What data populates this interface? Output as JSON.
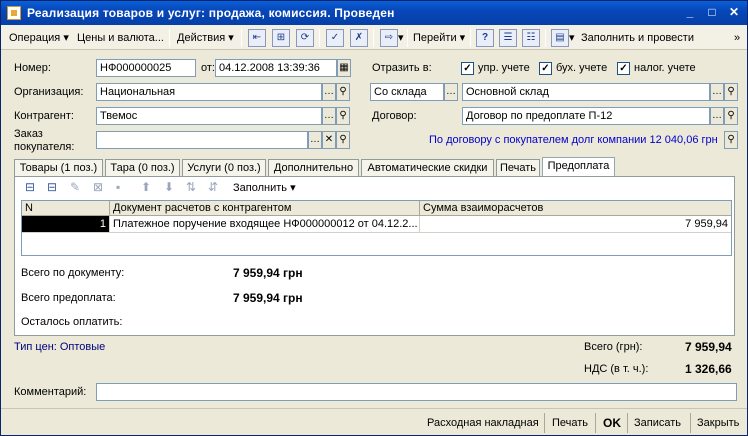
{
  "window": {
    "title": "Реализация товаров и услуг: продажа, комиссия. Проведен",
    "controls": [
      "_",
      "□",
      "✕"
    ]
  },
  "toolbar": {
    "operation": "Операция",
    "prices": "Цены и валюта...",
    "actions": "Действия",
    "goto": "Перейти",
    "help": "?",
    "fill_and_post": "Заполнить и провести"
  },
  "header": {
    "number_label": "Номер:",
    "number_value": "НФ000000025",
    "from_label": "от:",
    "date_value": "04.12.2008 13:39:36",
    "reflect_label": "Отразить в:",
    "reflect_checks": [
      {
        "label": "упр. учете",
        "checked": true
      },
      {
        "label": "бух. учете",
        "checked": true
      },
      {
        "label": "налог. учете",
        "checked": true
      }
    ],
    "org_label": "Организация:",
    "org_value": "Национальная",
    "warehouse_type_value": "Со склада",
    "warehouse_value": "Основной склад",
    "contractor_label": "Контрагент:",
    "contractor_value": "Твемос",
    "contract_label": "Договор:",
    "contract_value": "Договор по предоплате П-12",
    "order_label_1": "Заказ",
    "order_label_2": "покупателя:",
    "order_value": "",
    "debt_link": "По договору с покупателем долг компании 12 040,06 грн"
  },
  "tabs": [
    {
      "label": "Товары (1 поз.)",
      "active": false
    },
    {
      "label": "Тара (0 поз.)",
      "active": false
    },
    {
      "label": "Услуги (0 поз.)",
      "active": false
    },
    {
      "label": "Дополнительно",
      "active": false
    },
    {
      "label": "Автоматические скидки",
      "active": false
    },
    {
      "label": "Печать",
      "active": false
    },
    {
      "label": "Предоплата",
      "active": true
    }
  ],
  "prepayment": {
    "fill_label": "Заполнить",
    "columns": [
      "N",
      "Документ расчетов с контрагентом",
      "Сумма взаиморасчетов"
    ],
    "rows": [
      {
        "n": "1",
        "document": "Платежное поручение входящее НФ000000012 от 04.12.2...",
        "amount": "7 959,94"
      }
    ],
    "total_doc_label": "Всего по документу:",
    "total_doc_value": "7 959,94 грн",
    "total_prepay_label": "Всего предоплата:",
    "total_prepay_value": "7 959,94 грн",
    "remaining_label": "Осталось оплатить:"
  },
  "footer": {
    "price_type_link": "Тип цен: Оптовые",
    "total_label": "Всего (грн):",
    "total_value": "7 959,94",
    "vat_label": "НДС (в т. ч.):",
    "vat_value": "1 326,66",
    "comment_label": "Комментарий:",
    "comment_value": ""
  },
  "statusbar": {
    "invoice": "Расходная накладная",
    "print": "Печать",
    "ok": "OK",
    "save": "Записать",
    "close": "Закрыть"
  }
}
